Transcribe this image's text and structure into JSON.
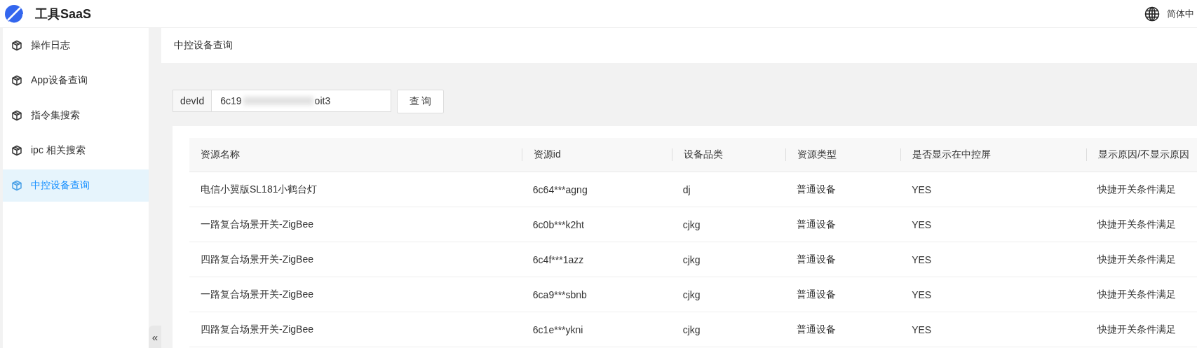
{
  "header": {
    "logo_text": "工具SaaS",
    "language": "简体中"
  },
  "sidebar": {
    "items": [
      {
        "label": "操作日志",
        "selected": false
      },
      {
        "label": "App设备查询",
        "selected": false
      },
      {
        "label": "指令集搜索",
        "selected": false
      },
      {
        "label": "ipc 相关搜索",
        "selected": false
      },
      {
        "label": "中控设备查询",
        "selected": true
      }
    ],
    "collapse": "«"
  },
  "breadcrumb": "中控设备查询",
  "search": {
    "label": "devId",
    "value_start": "6c19",
    "value_end": "oit3",
    "button": "查 询"
  },
  "table": {
    "columns": [
      "资源名称",
      "资源id",
      "设备品类",
      "资源类型",
      "是否显示在中控屏",
      "显示原因/不显示原因"
    ],
    "rows": [
      [
        "电信小翼版SL181小鹤台灯",
        "6c64***agng",
        "dj",
        "普通设备",
        "YES",
        "快捷开关条件满足"
      ],
      [
        "一路复合场景开关-ZigBee",
        "6c0b***k2ht",
        "cjkg",
        "普通设备",
        "YES",
        "快捷开关条件满足"
      ],
      [
        "四路复合场景开关-ZigBee",
        "6c4f***1azz",
        "cjkg",
        "普通设备",
        "YES",
        "快捷开关条件满足"
      ],
      [
        "一路复合场景开关-ZigBee",
        "6ca9***sbnb",
        "cjkg",
        "普通设备",
        "YES",
        "快捷开关条件满足"
      ],
      [
        "四路复合场景开关-ZigBee",
        "6c1e***ykni",
        "cjkg",
        "普通设备",
        "YES",
        "快捷开关条件满足"
      ]
    ]
  }
}
